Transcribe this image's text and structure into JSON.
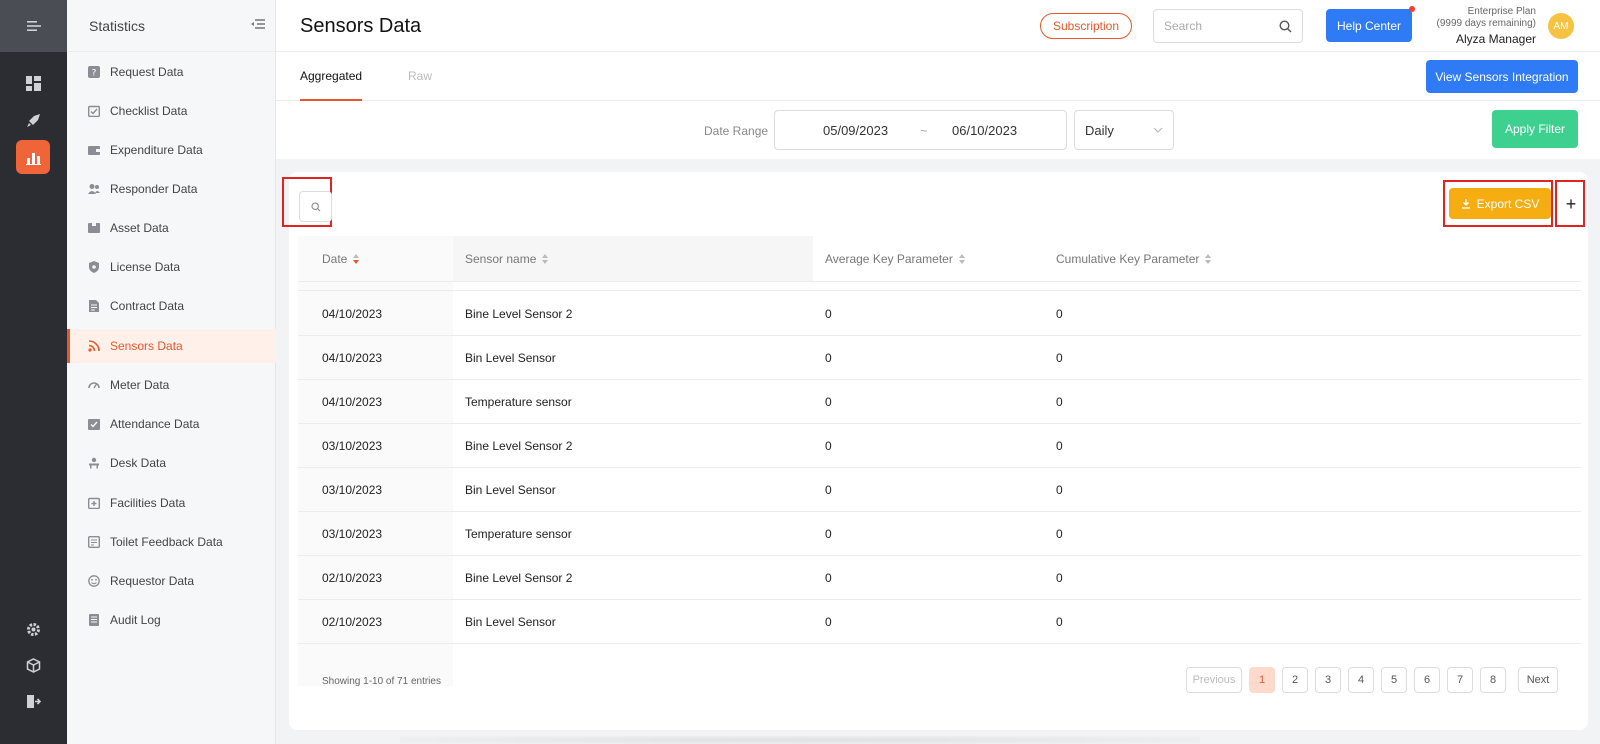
{
  "rail": {
    "icons": [
      "menu-toggle-icon",
      "dashboard-icon",
      "rocket-icon",
      "statistics-icon",
      "settings-icon",
      "cube-icon",
      "logout-icon"
    ]
  },
  "sidebar": {
    "title": "Statistics",
    "items": [
      {
        "label": "Request Data",
        "icon": "question-icon"
      },
      {
        "label": "Checklist Data",
        "icon": "checklist-icon"
      },
      {
        "label": "Expenditure Data",
        "icon": "wallet-icon"
      },
      {
        "label": "Responder Data",
        "icon": "users-icon"
      },
      {
        "label": "Asset Data",
        "icon": "asset-icon"
      },
      {
        "label": "License Data",
        "icon": "shield-icon"
      },
      {
        "label": "Contract Data",
        "icon": "contract-icon"
      },
      {
        "label": "Sensors Data",
        "icon": "rss-icon",
        "active": true
      },
      {
        "label": "Meter Data",
        "icon": "gauge-icon"
      },
      {
        "label": "Attendance Data",
        "icon": "attendance-icon"
      },
      {
        "label": "Desk Data",
        "icon": "desk-icon"
      },
      {
        "label": "Facilities Data",
        "icon": "facilities-icon"
      },
      {
        "label": "Toilet Feedback Data",
        "icon": "feedback-icon"
      },
      {
        "label": "Requestor Data",
        "icon": "smiley-icon"
      },
      {
        "label": "Audit Log",
        "icon": "log-icon"
      }
    ]
  },
  "header": {
    "title": "Sensors Data",
    "subscription_label": "Subscription",
    "search_placeholder": "Search",
    "help_label": "Help Center",
    "plan_name": "Enterprise Plan",
    "plan_remaining": "(9999 days remaining)",
    "user_name": "Alyza Manager",
    "avatar_initials": "AM"
  },
  "tabs": {
    "items": [
      {
        "label": "Aggregated",
        "active": true
      },
      {
        "label": "Raw",
        "active": false
      }
    ],
    "integration_label": "View Sensors Integration"
  },
  "filter": {
    "label": "Date Range",
    "start_date": "05/09/2023",
    "separator": "~",
    "end_date": "06/10/2023",
    "interval": "Daily",
    "apply_label": "Apply Filter"
  },
  "table": {
    "export_label": "Export CSV",
    "add_label": "+",
    "columns": [
      "Date",
      "Sensor name",
      "Average Key Parameter",
      "Cumulative Key Parameter"
    ],
    "rows": [
      [
        "04/10/2023",
        "Bine Level Sensor 2",
        "0",
        "0"
      ],
      [
        "04/10/2023",
        "Bin Level Sensor",
        "0",
        "0"
      ],
      [
        "04/10/2023",
        "Temperature sensor",
        "0",
        "0"
      ],
      [
        "03/10/2023",
        "Bine Level Sensor 2",
        "0",
        "0"
      ],
      [
        "03/10/2023",
        "Bin Level Sensor",
        "0",
        "0"
      ],
      [
        "03/10/2023",
        "Temperature sensor",
        "0",
        "0"
      ],
      [
        "02/10/2023",
        "Bine Level Sensor 2",
        "0",
        "0"
      ],
      [
        "02/10/2023",
        "Bin Level Sensor",
        "0",
        "0"
      ]
    ],
    "showing": "Showing 1-10 of 71 entries"
  },
  "pagination": {
    "previous": "Previous",
    "pages": [
      "1",
      "2",
      "3",
      "4",
      "5",
      "6",
      "7",
      "8"
    ],
    "current": "1",
    "next": "Next"
  },
  "colors": {
    "accent": "#e8572a",
    "primary": "#2f7bf5",
    "success": "#3ed08f",
    "warning": "#f6ad12",
    "rail": "#2b2d33"
  }
}
